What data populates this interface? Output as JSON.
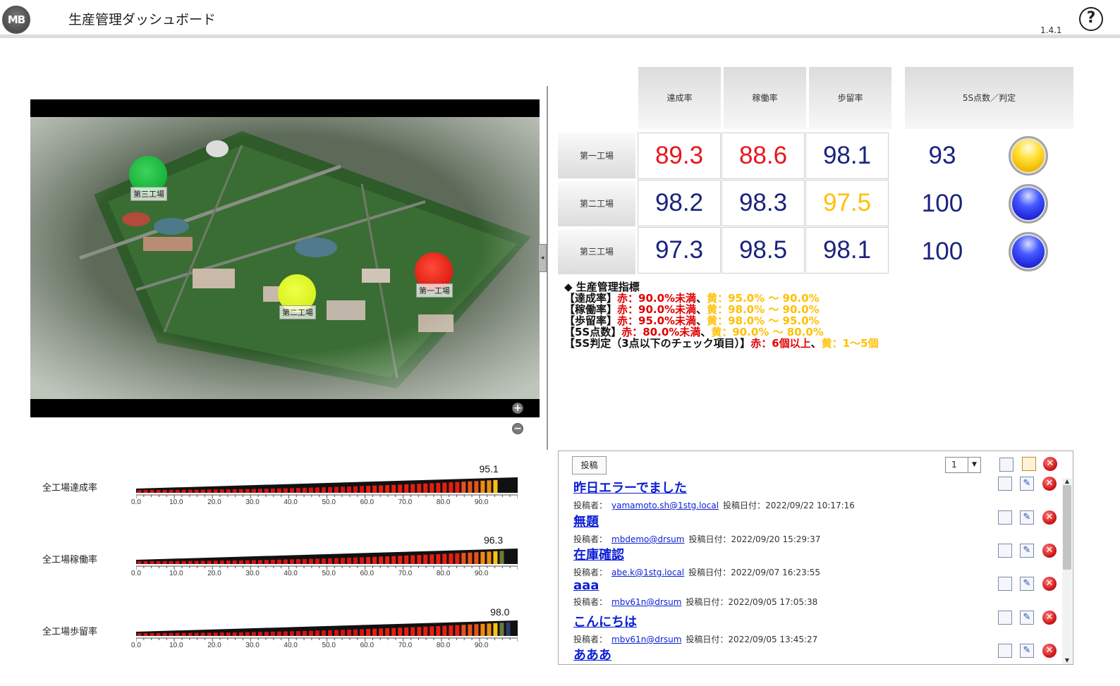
{
  "header": {
    "logo_text": "MB",
    "title": "生産管理ダッシュボード",
    "version": "1.4.1",
    "help_symbol": "?"
  },
  "map": {
    "markers": [
      {
        "label": "第三工場",
        "color": "#15b23a"
      },
      {
        "label": "第一工場",
        "color": "#e01e12"
      },
      {
        "label": "第二工場",
        "color": "#d6f21c"
      }
    ],
    "zoom_in": "+",
    "zoom_out": "−",
    "collapse_symbol": "◂"
  },
  "kpi": {
    "columns": [
      "達成率",
      "稼働率",
      "歩留率",
      "5S点数／判定"
    ],
    "rows": [
      {
        "name": "第一工場",
        "values": [
          {
            "v": "89.3",
            "color": "#e8161b"
          },
          {
            "v": "88.6",
            "color": "#e8161b"
          },
          {
            "v": "98.1",
            "color": "#1a237e"
          }
        ],
        "score": "93",
        "judge": "yellow"
      },
      {
        "name": "第二工場",
        "values": [
          {
            "v": "98.2",
            "color": "#1a237e"
          },
          {
            "v": "98.3",
            "color": "#1a237e"
          },
          {
            "v": "97.5",
            "color": "#ffc000"
          }
        ],
        "score": "100",
        "judge": "blue"
      },
      {
        "name": "第三工場",
        "values": [
          {
            "v": "97.3",
            "color": "#1a237e"
          },
          {
            "v": "98.5",
            "color": "#1a237e"
          },
          {
            "v": "98.1",
            "color": "#1a237e"
          }
        ],
        "score": "100",
        "judge": "blue"
      }
    ]
  },
  "legend": {
    "heading": "◆ 生産管理指標",
    "rows": [
      {
        "key": "【達成率】",
        "red": "赤：90.0%未満",
        "sep": "、",
        "yellow": "黄：95.0% 〜 90.0%"
      },
      {
        "key": "【稼働率】",
        "red": "赤：90.0%未満",
        "sep": "、",
        "yellow": "黄：98.0% 〜 90.0%"
      },
      {
        "key": "【歩留率】",
        "red": "赤：95.0%未満",
        "sep": "、",
        "yellow": "黄：98.0% 〜 95.0%"
      },
      {
        "key": "【5S点数】",
        "red": "赤：80.0%未満",
        "sep": "、",
        "yellow": "黄：90.0% 〜 80.0%"
      },
      {
        "key": "【5S判定（3点以下のチェック項目）】",
        "red": "赤：6個以上",
        "sep": "、",
        "yellow": "黄：1〜5個"
      }
    ]
  },
  "gauges": {
    "ticks": [
      "0.0",
      "10.0",
      "20.0",
      "30.0",
      "40.0",
      "50.0",
      "60.0",
      "70.0",
      "80.0",
      "90.0"
    ],
    "items": [
      {
        "label": "全工場達成率",
        "value": "95.1",
        "fraction": 0.951
      },
      {
        "label": "全工場稼働率",
        "value": "96.3",
        "fraction": 0.963
      },
      {
        "label": "全工場歩留率",
        "value": "98.0",
        "fraction": 0.98
      }
    ]
  },
  "bbs": {
    "post_button": "投稿",
    "page_value": "1",
    "author_label": "投稿者：",
    "date_label": "投稿日付：",
    "posts": [
      {
        "title": "昨日エラーでました",
        "author": "yamamoto.sh@1stg.local",
        "date": "2022/09/22 10:17:16"
      },
      {
        "title": "無題",
        "author": "mbdemo@drsum",
        "date": "2022/09/20 15:29:37"
      },
      {
        "title": "在庫確認",
        "author": "abe.k@1stg.local",
        "date": "2022/09/07 16:23:55"
      },
      {
        "title": "aaa",
        "author": "mbv61n@drsum",
        "date": "2022/09/05 17:05:38"
      },
      {
        "title": "こんにちは",
        "author": "mbv61n@drsum",
        "date": "2022/09/05 13:45:27"
      },
      {
        "title": "あああ",
        "author": "",
        "date": ""
      }
    ]
  }
}
